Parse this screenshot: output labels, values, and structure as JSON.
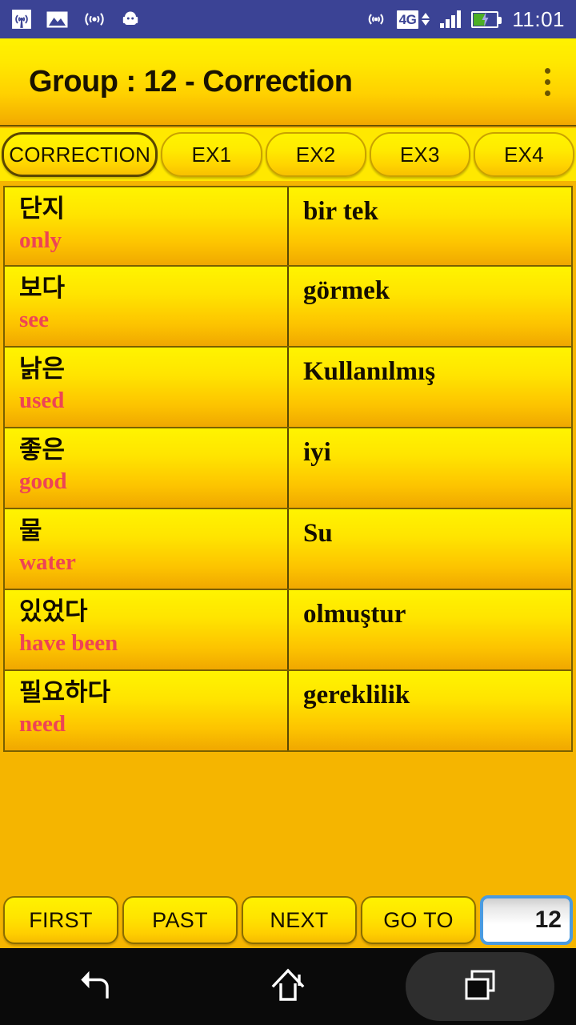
{
  "status_bar": {
    "time": "11:01",
    "network_label": "4G",
    "left_icons": [
      "broadcast-icon",
      "photo-icon",
      "wifi-signal-icon",
      "android-robot-icon"
    ],
    "right_icons": [
      "cast-icon",
      "network-4g-badge",
      "data-arrows-icon",
      "signal-bars-icon",
      "battery-charging-icon"
    ],
    "background_color": "#3B4395"
  },
  "title_bar": {
    "title": "Group : 12 - Correction",
    "overflow_menu_name": "more-options"
  },
  "tabs": [
    {
      "label": "CORRECTION",
      "selected": true
    },
    {
      "label": "EX1",
      "selected": false
    },
    {
      "label": "EX2",
      "selected": false
    },
    {
      "label": "EX3",
      "selected": false
    },
    {
      "label": "EX4",
      "selected": false
    }
  ],
  "list": {
    "rows": [
      {
        "term": "단지",
        "gloss": "only",
        "translation": "bir tek"
      },
      {
        "term": "보다",
        "gloss": "see",
        "translation": "görmek"
      },
      {
        "term": "낡은",
        "gloss": "used",
        "translation": "Kullanılmış"
      },
      {
        "term": "좋은",
        "gloss": "good",
        "translation": "iyi"
      },
      {
        "term": "물",
        "gloss": "water",
        "translation": "Su"
      },
      {
        "term": "있었다",
        "gloss": "have been",
        "translation": "olmuştur"
      },
      {
        "term": "필요하다",
        "gloss": "need",
        "translation": "gereklilik"
      }
    ]
  },
  "bottom_bar": {
    "buttons": [
      {
        "label": "FIRST"
      },
      {
        "label": "PAST"
      },
      {
        "label": "NEXT"
      },
      {
        "label": "GO TO"
      }
    ],
    "page_value": "12"
  },
  "android_nav": {
    "back_icon": "back-arrow-icon",
    "home_icon": "home-icon",
    "recents_icon": "recents-icon"
  },
  "colors": {
    "accent_yellow": "#FFE800",
    "background_orange": "#F5B500",
    "status_blue": "#3B4395",
    "gloss_red": "#EE4455",
    "input_border_blue": "#4A9BE0"
  }
}
